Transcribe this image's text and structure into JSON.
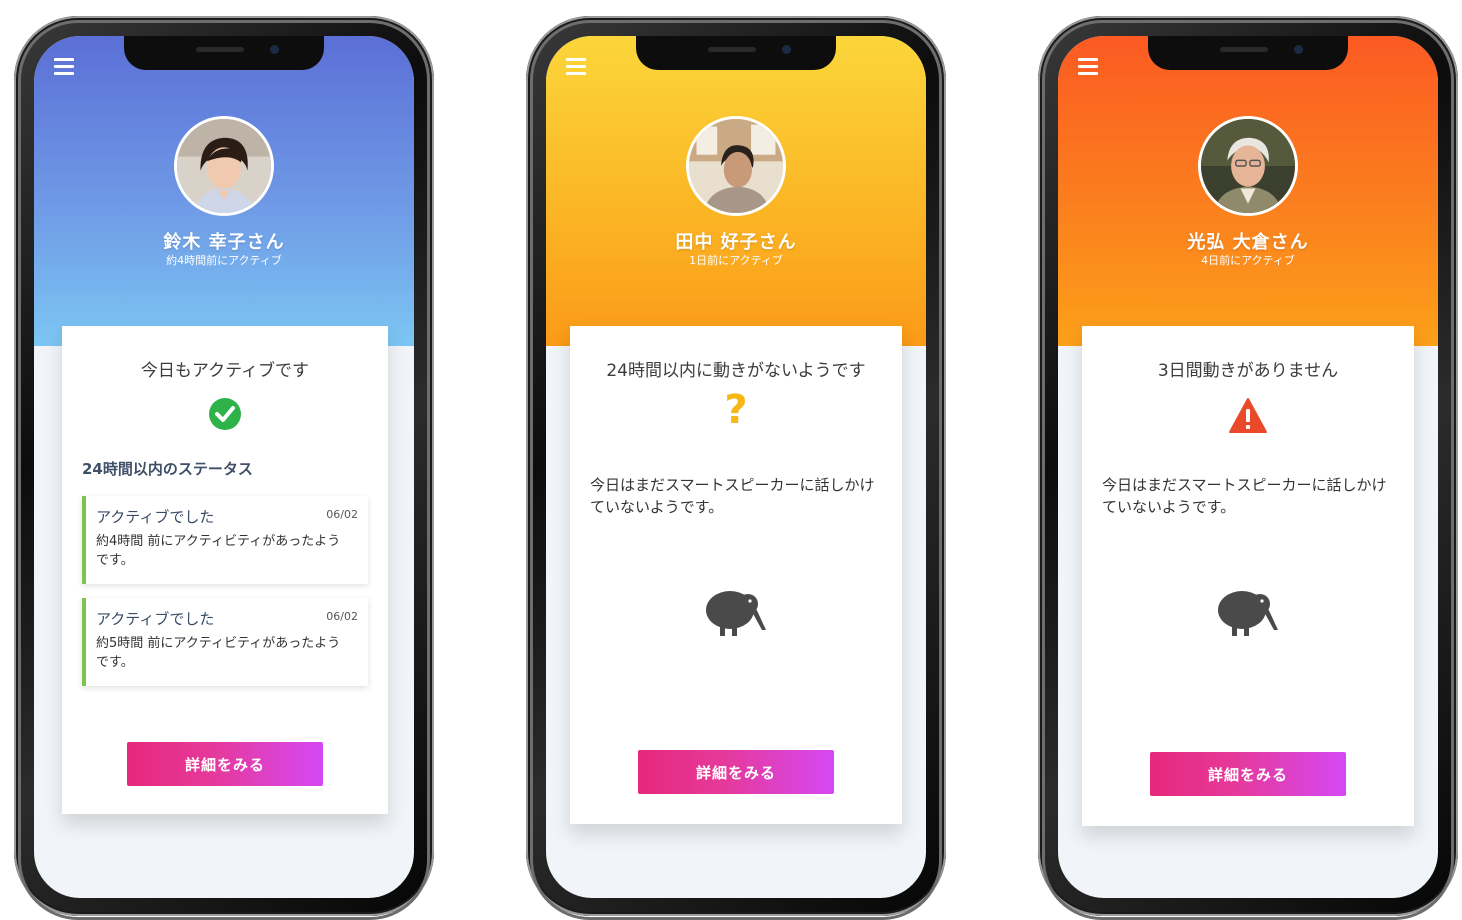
{
  "phones": [
    {
      "name": "鈴木 幸子さん",
      "last_active": "約4時間前にアクティブ",
      "status_title": "今日もアクティブです",
      "section_title": "24時間以内のステータス",
      "entries": [
        {
          "title": "アクティブでした",
          "date": "06/02",
          "desc": "約4時間 前にアクティビティがあったようです。"
        },
        {
          "title": "アクティブでした",
          "date": "06/02",
          "desc": "約5時間 前にアクティビティがあったようです。"
        }
      ],
      "button_label": "詳細をみる",
      "status_icon": "check-circle-icon",
      "colors": {
        "hero_top": "#5b6fd6",
        "hero_bottom": "#7cc6f3",
        "status": "#2fb24a"
      }
    },
    {
      "name": "田中 好子さん",
      "last_active": "1日前にアクティブ",
      "status_title": "24時間以内に動きがないようです",
      "status_symbol": "?",
      "message": "今日はまだスマートスピーカーに話しかけていないようです。",
      "button_label": "詳細をみる",
      "status_icon": "question-mark-icon",
      "colors": {
        "hero_top": "#fbd63a",
        "hero_bottom": "#fb9a18",
        "status": "#f5b815"
      }
    },
    {
      "name": "光弘 大倉さん",
      "last_active": "4日前にアクティブ",
      "status_title": "3日間動きがありません",
      "message": "今日はまだスマートスピーカーに話しかけていないようです。",
      "button_label": "詳細をみる",
      "status_icon": "warning-triangle-icon",
      "colors": {
        "hero_top": "#fb5a22",
        "hero_bottom": "#fca019",
        "status": "#ea4a2a"
      }
    }
  ]
}
